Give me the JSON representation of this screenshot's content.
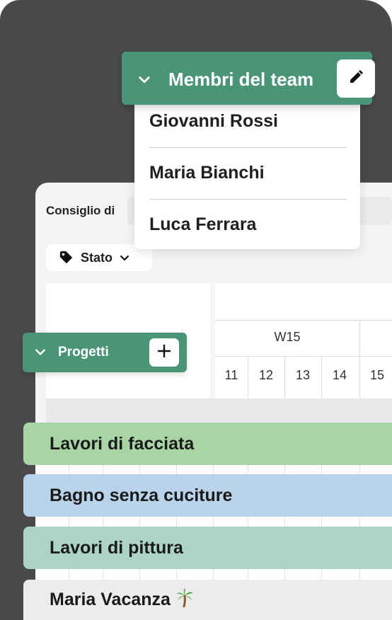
{
  "team": {
    "title": "Membri del team",
    "members": [
      "Giovanni Rossi",
      "Maria Bianchi",
      "Luca Ferrara"
    ]
  },
  "board": {
    "title": "Consiglio di",
    "filter_label": "Stato"
  },
  "timeline": {
    "week": "W15",
    "days": [
      "11",
      "12",
      "13",
      "14",
      "15"
    ]
  },
  "progetti": {
    "label": "Progetti"
  },
  "projects": [
    {
      "name": "Lavori di facciata",
      "color": "#a8d5a3"
    },
    {
      "name": "Bagno senza cuciture",
      "color": "#b8d3ea"
    },
    {
      "name": "Lavori di pittura",
      "color": "#acd3c7"
    },
    {
      "name": "Maria Vacanza",
      "emoji": "🌴",
      "color": "#ececec"
    }
  ],
  "colors": {
    "accent": "#4a9477",
    "background_dark": "#4b4a4b"
  },
  "icons": [
    "chevron-down-icon",
    "edit-pencil-icon",
    "tag-icon",
    "plus-icon"
  ]
}
